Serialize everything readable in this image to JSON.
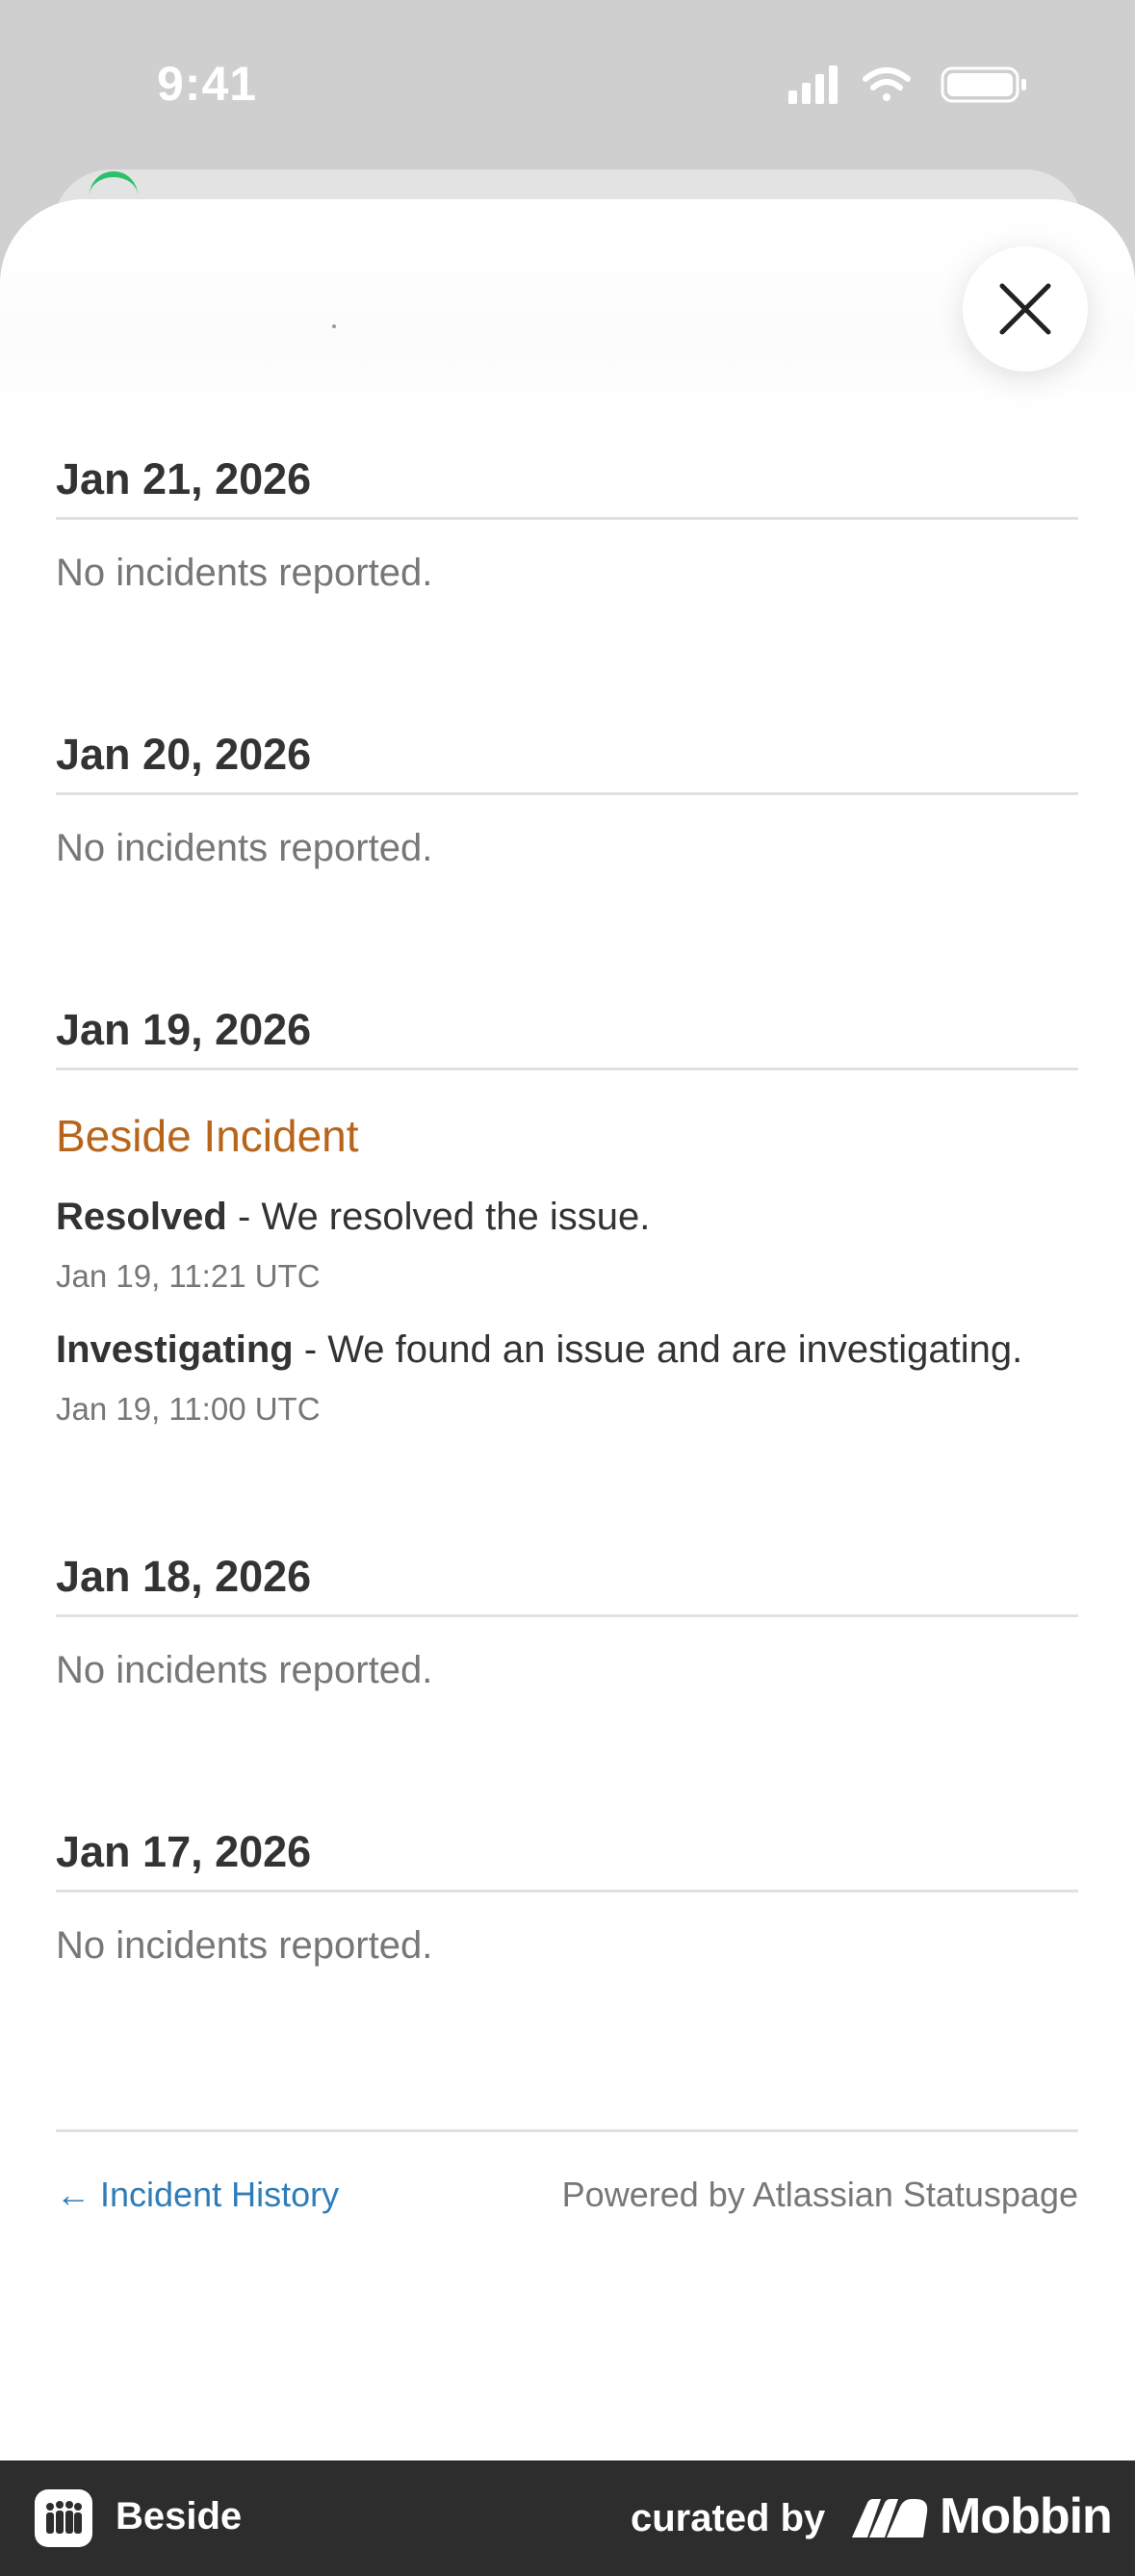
{
  "status_bar": {
    "time": "9:41",
    "icons": [
      "signal-icon",
      "wifi-icon",
      "battery-icon"
    ]
  },
  "sheet": {
    "close_icon": "close-icon"
  },
  "days": [
    {
      "date": "Jan 21, 2026",
      "empty_text": "No incidents reported."
    },
    {
      "date": "Jan 20, 2026",
      "empty_text": "No incidents reported."
    },
    {
      "date": "Jan 19, 2026",
      "incident": {
        "title": "Beside Incident",
        "updates": [
          {
            "status": "Resolved",
            "message": " - We resolved the issue.",
            "time": "Jan 19, 11:21 UTC"
          },
          {
            "status": "Investigating",
            "message": " - We found an issue and are investigating.",
            "time": "Jan 19, 11:00 UTC"
          }
        ]
      }
    },
    {
      "date": "Jan 18, 2026",
      "empty_text": "No incidents reported."
    },
    {
      "date": "Jan 17, 2026",
      "empty_text": "No incidents reported."
    }
  ],
  "footer": {
    "history_link": "← Incident History",
    "powered_by": "Powered by Atlassian Statuspage"
  },
  "bottom_bar": {
    "app_name": "Beside",
    "curated_by": "curated by",
    "brand": "Mobbin"
  },
  "colors": {
    "incident_title": "#b8651b",
    "link": "#2f7db8",
    "bottom_bar": "#2d2d2d"
  }
}
